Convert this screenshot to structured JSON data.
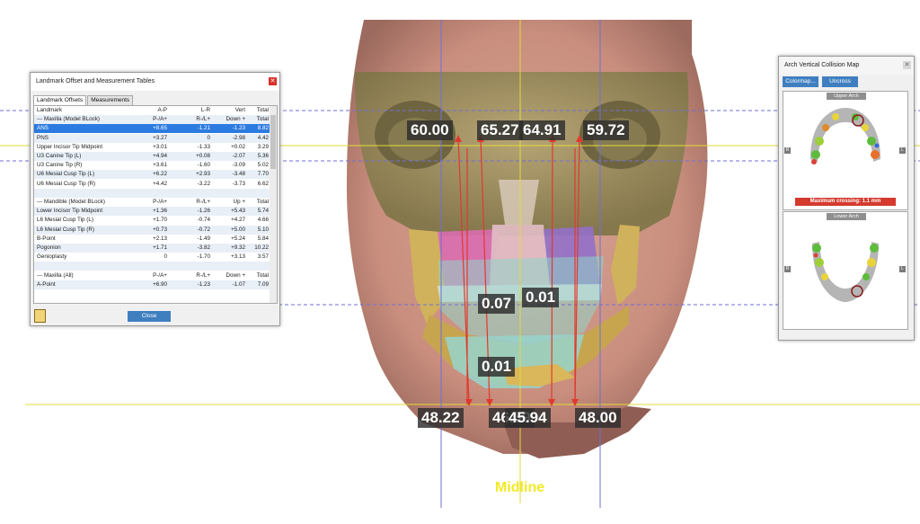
{
  "viewport": {
    "measurements": {
      "upper": [
        "60.00",
        "65.27",
        "64.91",
        "59.72"
      ],
      "lower": [
        "48.22",
        "46.59",
        "45.94",
        "48.00"
      ],
      "lip_left": "0.07",
      "lip_right": "0.01",
      "chin": "0.01"
    },
    "midline_label": "Midline"
  },
  "landmark_window": {
    "title": "Landmark Offset and Measurement Tables",
    "tabs": [
      "Landmark Offsets",
      "Measurements"
    ],
    "rows": [
      [
        "Landmark",
        "A-P",
        "L-R",
        "Vert",
        "Total"
      ],
      [
        "--- Maxilla (Model BLock)",
        "P-/A+",
        "R-/L+",
        "Down +",
        "Total"
      ],
      [
        "ANS",
        "+8.65",
        "-1.21",
        "-1.23",
        "8.82"
      ],
      [
        "PNS",
        "+3.27",
        "0",
        "-2.98",
        "4.42"
      ],
      [
        "Upper Incisor Tip Midpoint",
        "+3.01",
        "-1.33",
        "+0.02",
        "3.29"
      ],
      [
        "U3 Canine Tip (L)",
        "+4.94",
        "+0.08",
        "-2.07",
        "5.36"
      ],
      [
        "U3 Canine Tip (R)",
        "+3.61",
        "-1.60",
        "-3.09",
        "5.02"
      ],
      [
        "U6 Mesial Cusp Tip (L)",
        "+6.22",
        "+2.93",
        "-3.48",
        "7.70"
      ],
      [
        "U6 Mesial Cusp Tip (R)",
        "+4.42",
        "-3.22",
        "-3.73",
        "6.62"
      ],
      [
        "",
        "",
        "",
        "",
        ""
      ],
      [
        "--- Mandible (Model BLock)",
        "P-/A+",
        "R-/L+",
        "Up +",
        "Total"
      ],
      [
        "Lower Incisor Tip Midpoint",
        "+1.36",
        "-1.26",
        "+5.43",
        "5.74"
      ],
      [
        "L6 Mesial Cusp Tip (L)",
        "+1.70",
        "-0.74",
        "+4.27",
        "4.66"
      ],
      [
        "L6 Mesial Cusp Tip (R)",
        "+0.73",
        "-0.72",
        "+5.00",
        "5.10"
      ],
      [
        "B-Point",
        "+2.13",
        "-1.49",
        "+5.24",
        "5.84"
      ],
      [
        "Pogonion",
        "+1.71",
        "-3.82",
        "+9.32",
        "10.22"
      ],
      [
        "Genioplasty",
        "0",
        "-1.70",
        "+3.13",
        "3.57"
      ],
      [
        "",
        "",
        "",
        "",
        ""
      ],
      [
        "--- Maxilla (All)",
        "P-/A+",
        "R-/L+",
        "Down +",
        "Total"
      ],
      [
        "A-Point",
        "+6.90",
        "-1.23",
        "-1.07",
        "7.09"
      ]
    ],
    "close_label": "Close"
  },
  "arch_window": {
    "title": "Arch Vertical Collision Map",
    "buttons": [
      "Colormap...",
      "Uncross"
    ],
    "upper_label": "Upper Arch",
    "lower_label": "Lower Arch",
    "warning": "Maximum crossing: 1.1 mm",
    "side_left": "R",
    "side_right": "L"
  }
}
